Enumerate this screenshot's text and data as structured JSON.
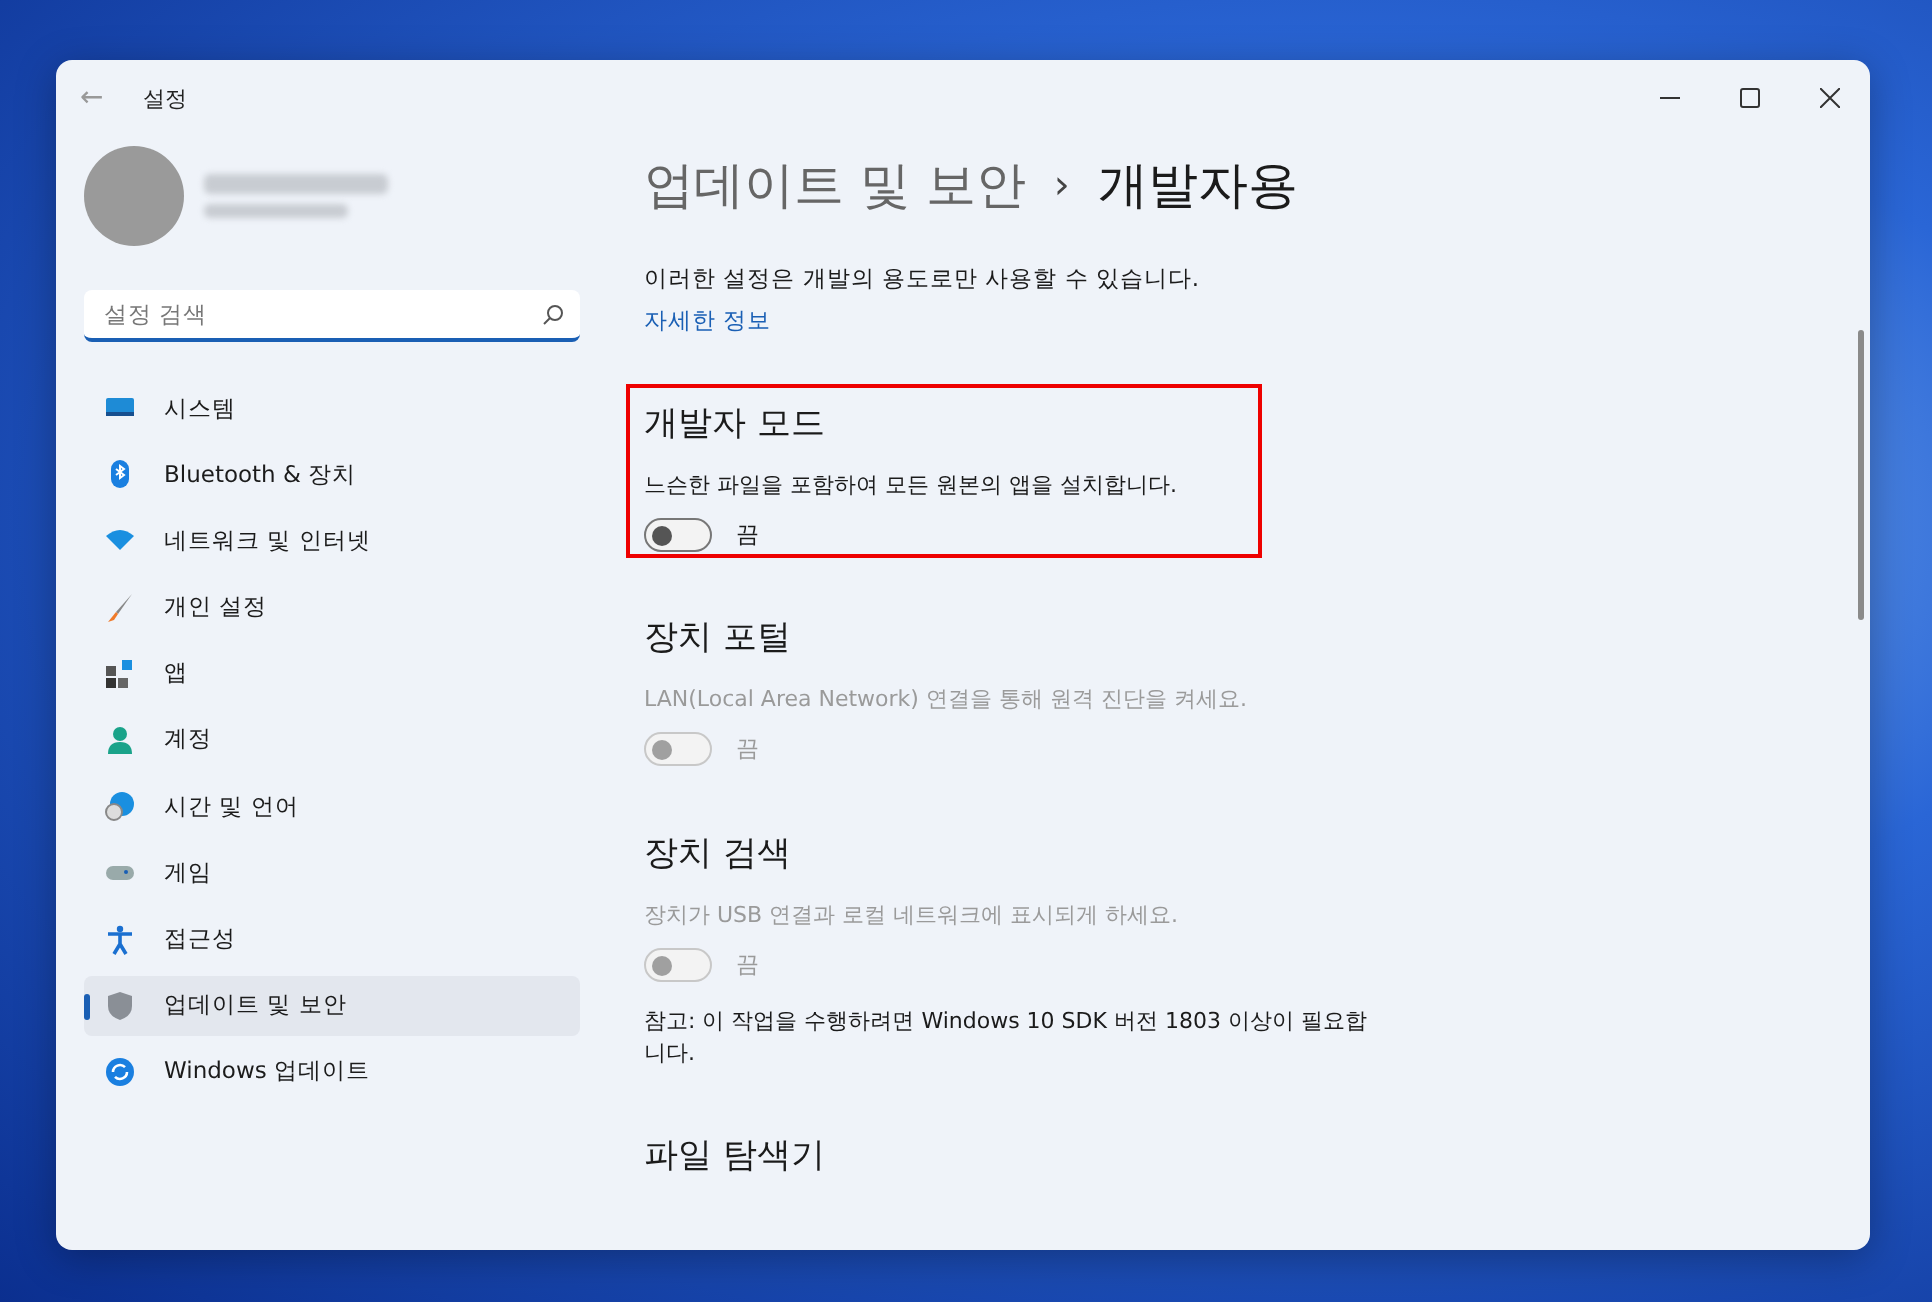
{
  "window": {
    "title": "설정",
    "back": "←"
  },
  "search": {
    "placeholder": "설정 검색"
  },
  "sidebar": {
    "items": [
      {
        "label": "시스템",
        "selected": false
      },
      {
        "label": "Bluetooth & 장치",
        "selected": false
      },
      {
        "label": "네트워크 및 인터넷",
        "selected": false
      },
      {
        "label": "개인 설정",
        "selected": false
      },
      {
        "label": "앱",
        "selected": false
      },
      {
        "label": "계정",
        "selected": false
      },
      {
        "label": "시간 및 언어",
        "selected": false
      },
      {
        "label": "게임",
        "selected": false
      },
      {
        "label": "접근성",
        "selected": false
      },
      {
        "label": "업데이트 및 보안",
        "selected": true
      },
      {
        "label": "Windows 업데이트",
        "selected": false
      }
    ]
  },
  "breadcrumb": {
    "parent": "업데이트 및 보안",
    "separator": "›",
    "current": "개발자용"
  },
  "intro": "이러한 설정은 개발의 용도로만 사용할 수 있습니다.",
  "link": "자세한 정보",
  "sections": [
    {
      "title": "개발자 모드",
      "highlighted": true,
      "description": "느슨한 파일을 포함하여 모든 원본의 앱을 설치합니다.",
      "toggle": {
        "on": false,
        "disabled": false,
        "label": "끔"
      }
    },
    {
      "title": "장치 포털",
      "highlighted": false,
      "description": "LAN(Local Area Network) 연결을 통해 원격 진단을 켜세요.",
      "toggle": {
        "on": false,
        "disabled": true,
        "label": "끔"
      }
    },
    {
      "title": "장치 검색",
      "highlighted": false,
      "description": "장치가 USB 연결과 로컬 네트워크에 표시되게 하세요.",
      "toggle": {
        "on": false,
        "disabled": true,
        "label": "끔"
      },
      "note": "참고: 이 작업을 수행하려면 Windows 10 SDK 버전 1803 이상이 필요합니다."
    },
    {
      "title": "파일 탐색기",
      "highlighted": false
    }
  ]
}
